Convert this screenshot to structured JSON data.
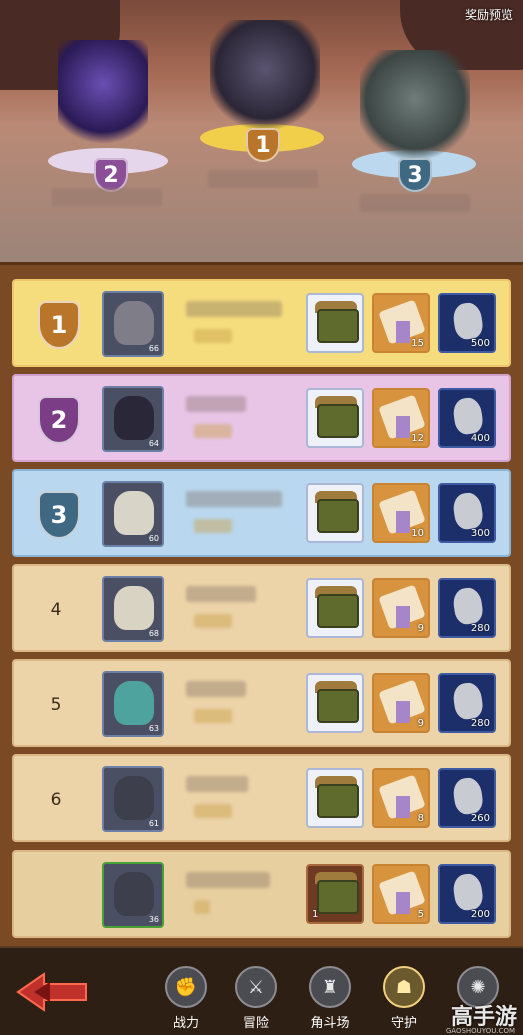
{
  "header": {
    "preview_label": "奖励预览"
  },
  "podium": [
    {
      "rank": "2",
      "color": "#8a4f96"
    },
    {
      "rank": "1",
      "color": "#b9762b"
    },
    {
      "rank": "3",
      "color": "#3f6882"
    }
  ],
  "rankings": [
    {
      "rank": "1",
      "tier": "gold",
      "level": "66",
      "rewards": {
        "scroll_qty": "15",
        "stone_qty": "500"
      }
    },
    {
      "rank": "2",
      "tier": "purple",
      "level": "64",
      "rewards": {
        "scroll_qty": "12",
        "stone_qty": "400"
      }
    },
    {
      "rank": "3",
      "tier": "blue",
      "level": "60",
      "rewards": {
        "scroll_qty": "10",
        "stone_qty": "300"
      }
    },
    {
      "rank": "4",
      "tier": "normal",
      "level": "68",
      "rewards": {
        "scroll_qty": "9",
        "stone_qty": "280"
      }
    },
    {
      "rank": "5",
      "tier": "normal",
      "level": "63",
      "rewards": {
        "scroll_qty": "9",
        "stone_qty": "280"
      }
    },
    {
      "rank": "6",
      "tier": "normal",
      "level": "61",
      "rewards": {
        "scroll_qty": "8",
        "stone_qty": "260"
      }
    },
    {
      "rank": "",
      "tier": "mine",
      "level": "36",
      "rewards": {
        "chest_qty": "1",
        "scroll_qty": "5",
        "stone_qty": "200"
      }
    }
  ],
  "nav": {
    "items": [
      {
        "label": "战力",
        "icon": "fist-icon"
      },
      {
        "label": "冒险",
        "icon": "crossed-axes-icon"
      },
      {
        "label": "角斗场",
        "icon": "arena-icon"
      },
      {
        "label": "守护",
        "icon": "tower-icon"
      },
      {
        "label": "",
        "icon": "guild-icon"
      }
    ],
    "active_index": 3
  },
  "watermark": {
    "text": "高手游",
    "sub": "GAOSHOUYOU.COM"
  },
  "colors": {
    "panel_bg": "#7a4a24",
    "gold": "#f5dd7e",
    "purple": "#e8c5e6",
    "blue": "#b9d7ee",
    "normal": "#ecd3a8"
  }
}
